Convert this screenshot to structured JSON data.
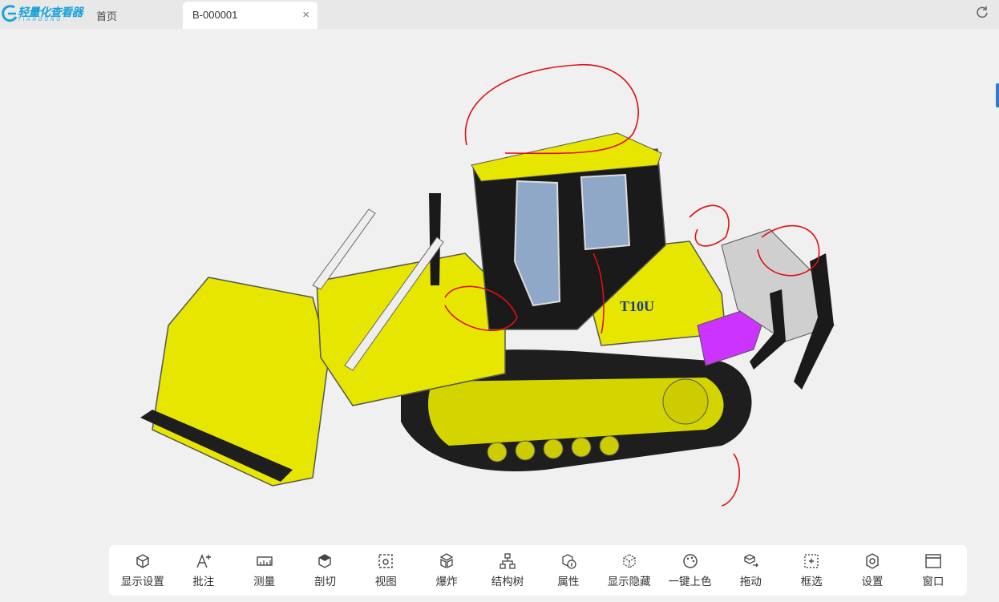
{
  "brand": {
    "name": "轻量化查看器",
    "subtitle": "TIANGONG"
  },
  "tabs": {
    "home": "首页",
    "active": "B-000001",
    "close": "×"
  },
  "toolbar": [
    {
      "label": "显示设置",
      "icon": "display-settings-icon"
    },
    {
      "label": "批注",
      "icon": "annotate-icon"
    },
    {
      "label": "测量",
      "icon": "measure-icon"
    },
    {
      "label": "剖切",
      "icon": "section-icon"
    },
    {
      "label": "视图",
      "icon": "view-icon"
    },
    {
      "label": "爆炸",
      "icon": "explode-icon"
    },
    {
      "label": "结构树",
      "icon": "tree-icon"
    },
    {
      "label": "属性",
      "icon": "properties-icon"
    },
    {
      "label": "显示隐藏",
      "icon": "show-hide-icon"
    },
    {
      "label": "一键上色",
      "icon": "palette-icon"
    },
    {
      "label": "拖动",
      "icon": "drag-icon"
    },
    {
      "label": "框选",
      "icon": "box-select-icon"
    },
    {
      "label": "设置",
      "icon": "gear-icon"
    },
    {
      "label": "窗口",
      "icon": "window-icon"
    }
  ],
  "model": {
    "decal": "T10U",
    "colors": {
      "body": "#e6e600",
      "accent": "#cc33ff",
      "track": "#222222"
    }
  }
}
